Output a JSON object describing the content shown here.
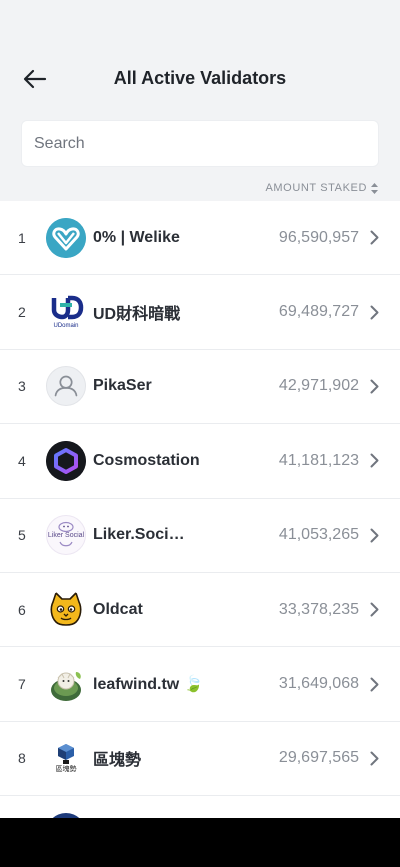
{
  "header": {
    "title": "All Active Validators"
  },
  "search": {
    "placeholder": "Search"
  },
  "sort": {
    "label": "AMOUNT STAKED"
  },
  "validators": [
    {
      "rank": "1",
      "name": "0% | Welike",
      "amount": "96,590,957",
      "avatar_icon": "welike-heart-logo-icon"
    },
    {
      "rank": "2",
      "name": "UD財科暗戰",
      "amount": "69,489,727",
      "avatar_icon": "udomain-logo-icon",
      "avatar_text": "UDomain"
    },
    {
      "rank": "3",
      "name": "PikaSer",
      "amount": "42,971,902",
      "avatar_icon": "default-user-icon"
    },
    {
      "rank": "4",
      "name": "Cosmostation",
      "amount": "41,181,123",
      "avatar_icon": "cosmostation-hexagon-icon"
    },
    {
      "rank": "5",
      "name": "Liker.Soci…",
      "amount": "41,053,265",
      "avatar_icon": "liker-social-logo-icon",
      "avatar_text": "Liker Social"
    },
    {
      "rank": "6",
      "name": "Oldcat",
      "amount": "33,378,235",
      "avatar_icon": "cat-face-icon"
    },
    {
      "rank": "7",
      "name": "leafwind.tw 🍃",
      "amount": "31,649,068",
      "avatar_icon": "leafwind-avatar-icon"
    },
    {
      "rank": "8",
      "name": "區塊勢",
      "amount": "29,697,565",
      "avatar_icon": "qu-kuai-shi-logo-icon",
      "avatar_text": "區塊勢"
    }
  ],
  "colors": {
    "accent_teal": "#3aa6c4",
    "ud_blue": "#1a2d8a",
    "cosmo_purple": "#7a4df0"
  }
}
